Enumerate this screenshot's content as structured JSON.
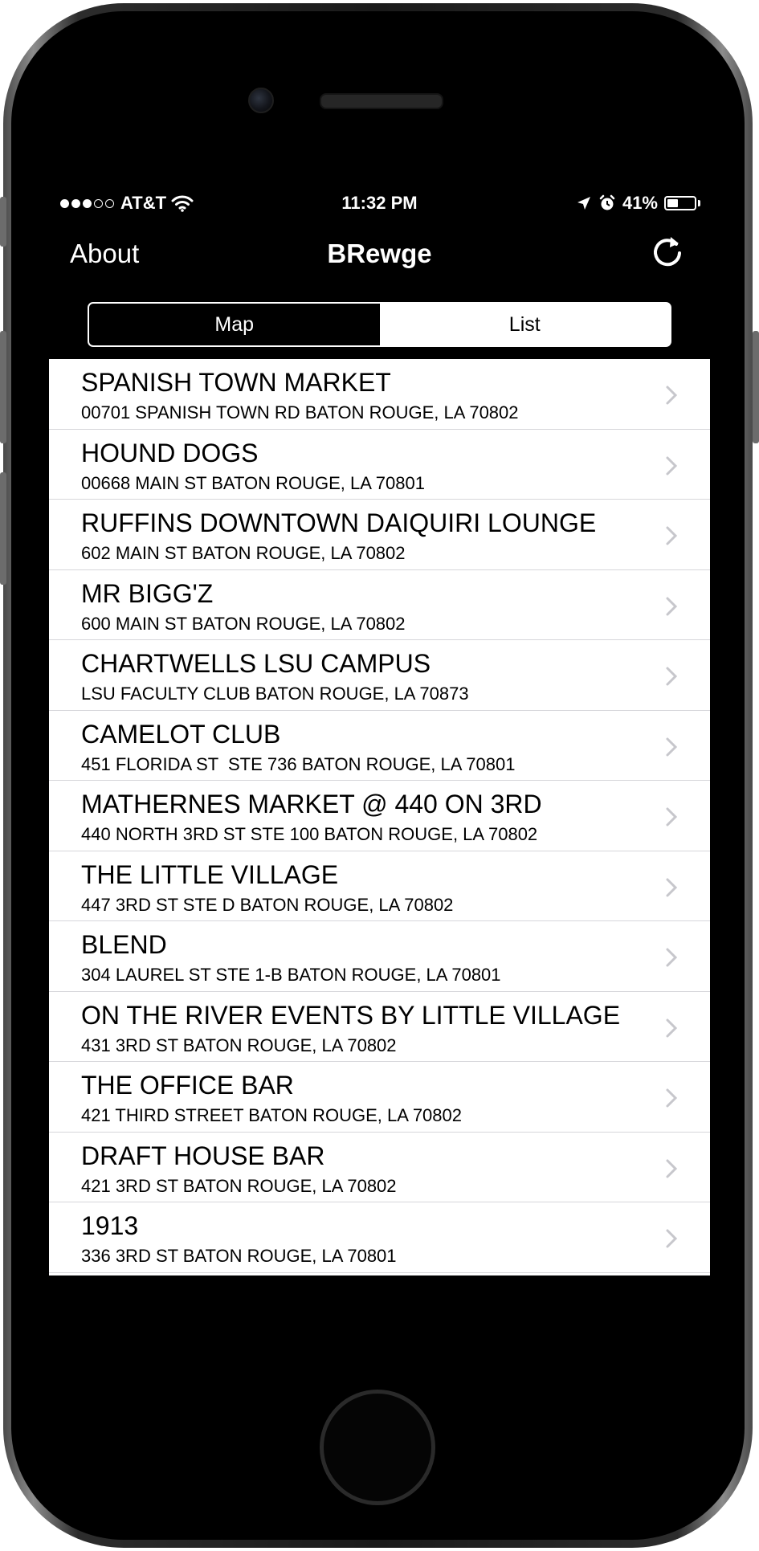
{
  "status_bar": {
    "carrier": "AT&T",
    "signal_filled": 3,
    "signal_total": 5,
    "time": "11:32 PM",
    "battery": "41%",
    "battery_level": 0.41
  },
  "nav": {
    "left_label": "About",
    "title": "BRewge",
    "right_icon": "refresh-icon"
  },
  "segments": [
    {
      "label": "Map",
      "selected": true
    },
    {
      "label": "List",
      "selected": false
    }
  ],
  "list": [
    {
      "name": "SPANISH TOWN MARKET",
      "address": "00701 SPANISH TOWN RD BATON ROUGE, LA 70802"
    },
    {
      "name": "HOUND DOGS",
      "address": "00668 MAIN ST BATON ROUGE, LA 70801"
    },
    {
      "name": "RUFFINS DOWNTOWN DAIQUIRI LOUNGE",
      "address": "602 MAIN ST BATON ROUGE, LA 70802"
    },
    {
      "name": "MR BIGG'Z",
      "address": "600 MAIN ST BATON ROUGE, LA 70802"
    },
    {
      "name": "CHARTWELLS LSU CAMPUS",
      "address": "LSU FACULTY CLUB BATON ROUGE, LA 70873"
    },
    {
      "name": "CAMELOT CLUB",
      "address": "451 FLORIDA ST  STE 736 BATON ROUGE, LA 70801"
    },
    {
      "name": "MATHERNES MARKET @ 440 ON 3RD",
      "address": "440 NORTH 3RD ST STE 100 BATON ROUGE, LA 70802"
    },
    {
      "name": "THE LITTLE VILLAGE",
      "address": "447 3RD ST STE D BATON ROUGE, LA 70802"
    },
    {
      "name": "BLEND",
      "address": "304 LAUREL ST STE 1-B BATON ROUGE, LA 70801"
    },
    {
      "name": "ON THE RIVER EVENTS BY LITTLE VILLAGE",
      "address": "431 3RD ST BATON ROUGE, LA 70802"
    },
    {
      "name": "THE OFFICE BAR",
      "address": "421 THIRD STREET BATON ROUGE, LA 70802"
    },
    {
      "name": "DRAFT HOUSE BAR",
      "address": "421 3RD ST BATON ROUGE, LA 70802"
    },
    {
      "name": "1913",
      "address": "336 3RD ST BATON ROUGE, LA 70801"
    }
  ],
  "colors": {
    "screen_bg": "#000000",
    "list_bg": "#ffffff",
    "separator": "#d6d6da",
    "chevron": "#c7c7cc"
  }
}
